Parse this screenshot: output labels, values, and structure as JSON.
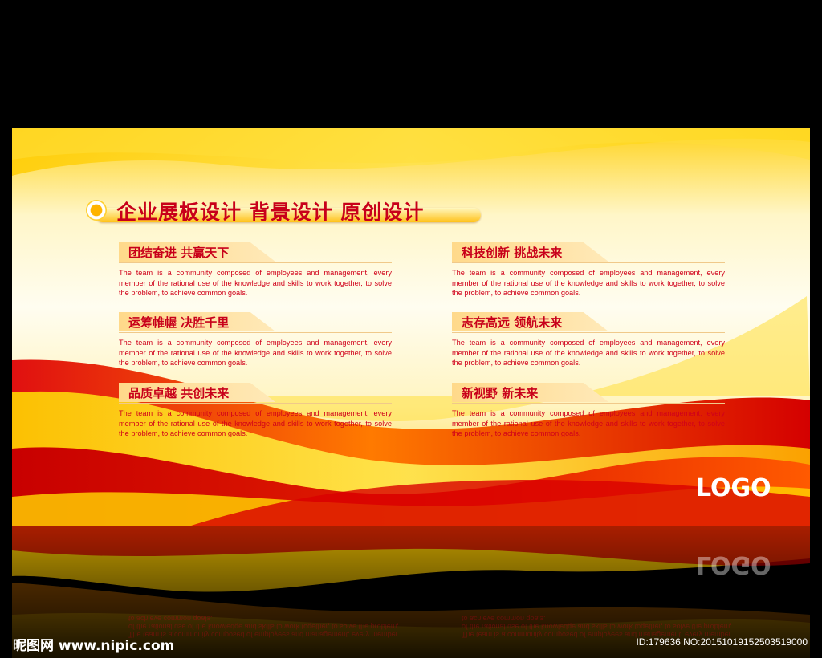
{
  "main_title": "企业展板设计 背景设计 原创设计",
  "description": "The team is a community composed of employees and management, every member of the rational use of the knowledge and skills to work together, to solve the problem, to achieve common goals.",
  "items": [
    {
      "heading": "团结奋进 共赢天下"
    },
    {
      "heading": "科技创新 挑战未来"
    },
    {
      "heading": "运筹帷幄 决胜千里"
    },
    {
      "heading": "志存高远 领航未来"
    },
    {
      "heading": "品质卓越 共创未来"
    },
    {
      "heading": "新视野 新未来"
    }
  ],
  "logo_text": "LOGO",
  "watermark_left": "昵图网 www.nipic.com",
  "watermark_right": "ID:179636 NO:20151019152503519000",
  "colors": {
    "accent_red": "#c8001a",
    "accent_yellow": "#ffcc00",
    "background": "#000000"
  }
}
